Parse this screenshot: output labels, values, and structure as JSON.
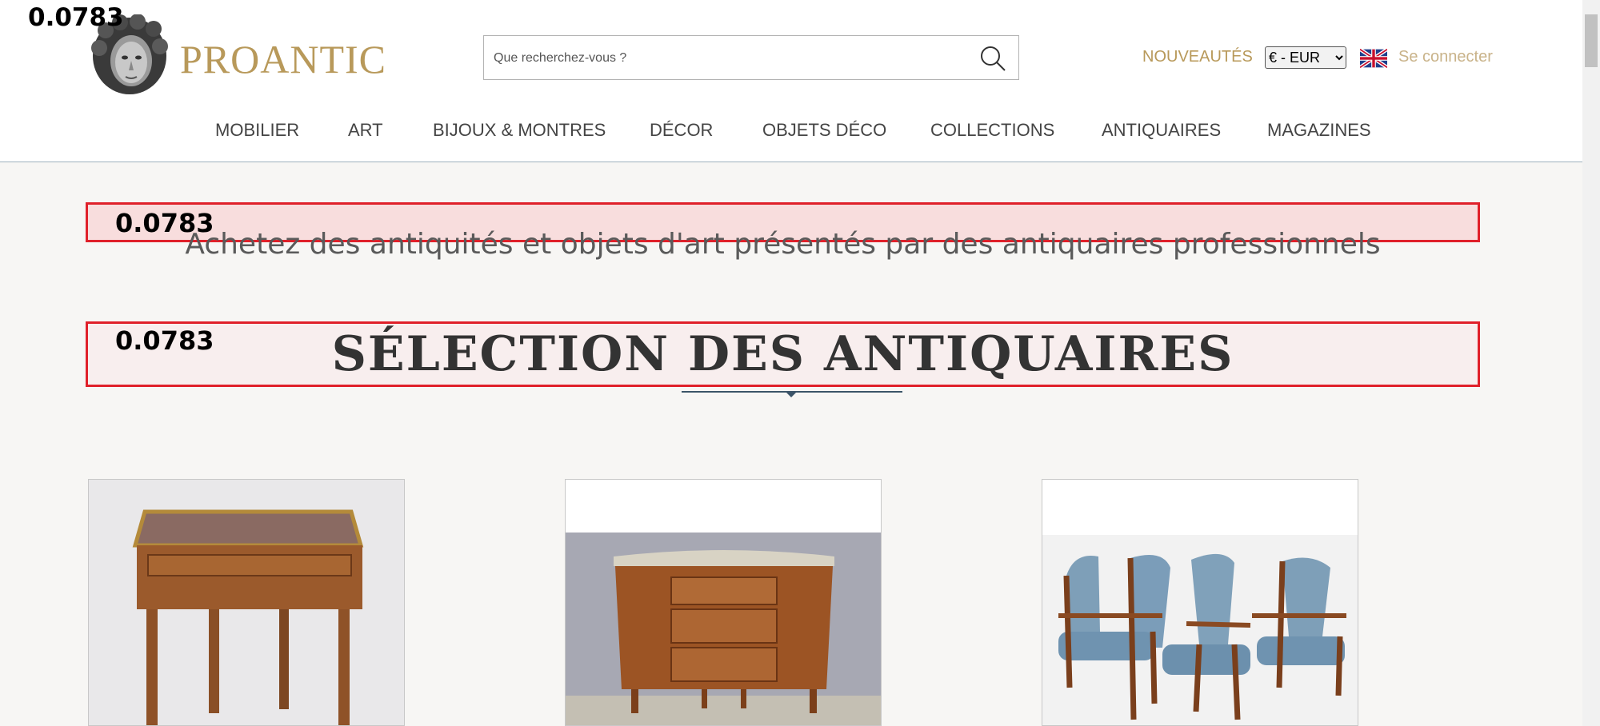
{
  "debug": {
    "top_value": "0.0783",
    "tagline_value": "0.0783",
    "section_value": "0.0783"
  },
  "brand": {
    "name": "PROANTIC",
    "color": "#b8995a"
  },
  "search": {
    "placeholder": "Que recherchez-vous ?"
  },
  "header": {
    "new_label": "NOUVEAUTÉS",
    "currency_selected": "€ - EUR",
    "login_label": "Se connecter"
  },
  "nav": [
    "MOBILIER",
    "ART",
    "BIJOUX & MONTRES",
    "DÉCOR",
    "OBJETS DÉCO",
    "COLLECTIONS",
    "ANTIQUAIRES",
    "MAGAZINES"
  ],
  "main": {
    "tagline": "Achetez des antiquités et objets d'art présentés par des antiquaires professionnels",
    "section_title": "SÉLECTION DES ANTIQUAIRES"
  },
  "colors": {
    "accent_border": "#e0202a",
    "divider": "#3c5569"
  }
}
